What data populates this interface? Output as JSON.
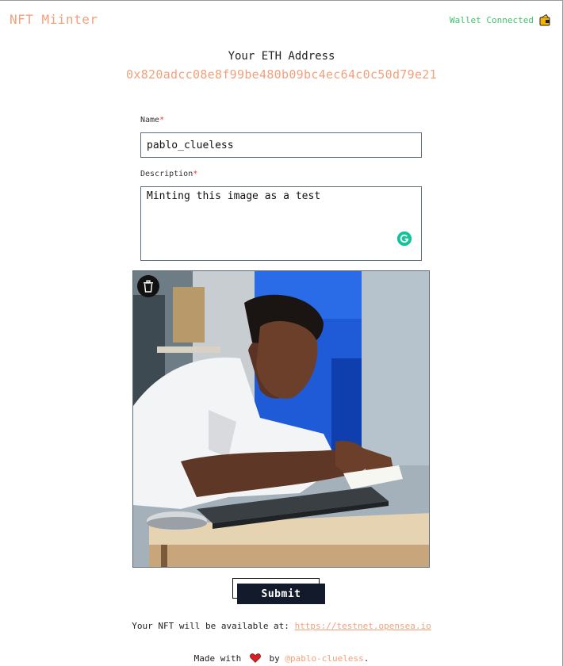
{
  "header": {
    "brand": "NFT Miinter",
    "wallet_status": "Wallet Connected",
    "wallet_icon": "wallet-icon"
  },
  "eth": {
    "title": "Your ETH Address",
    "address": "0x820adcc08e8f99be480b09bc4ec64c0c50d79e21"
  },
  "form": {
    "name_label": "Name",
    "description_label": "Description",
    "required_mark": "*",
    "name_value": "pablo_clueless",
    "description_value": "Minting this image as a test",
    "submit_label": "Submit"
  },
  "image": {
    "delete_icon": "trash-icon",
    "alt": "Person writing at a desk with a laptop"
  },
  "result": {
    "text": "Your NFT will be available at: ",
    "link": "https://testnet.opensea.io"
  },
  "footer": {
    "made_with": "Made with",
    "by": "by",
    "handle": "@pablo-clueless",
    "dot": "."
  },
  "colors": {
    "accent": "#f2a07b",
    "connected": "#3ec46d",
    "button": "#121a2b",
    "required": "#e53935"
  }
}
